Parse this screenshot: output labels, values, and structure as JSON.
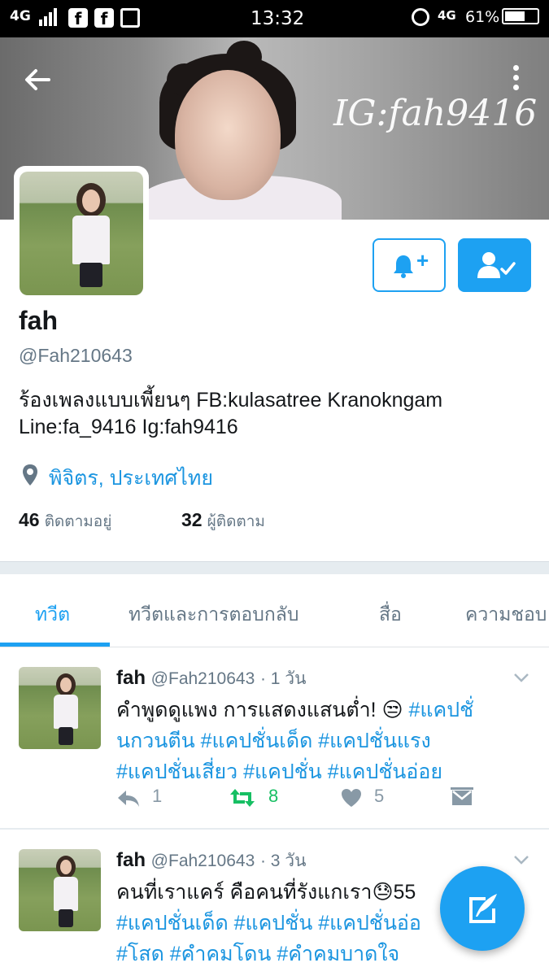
{
  "status_bar": {
    "network": "4G",
    "time": "13:32",
    "network2": "4G",
    "battery": "61%"
  },
  "banner": {
    "watermark": "IG:fah9416"
  },
  "profile": {
    "name": "fah",
    "handle": "@Fah210643",
    "bio": "ร้องเพลงแบบเพี้ยนๆ FB:kulasatree  Kranokngam Line:fa_9416 Ig:fah9416",
    "location": "พิจิตร, ประเทศไทย",
    "following_count": "46",
    "following_label": "ติดตามอยู่",
    "followers_count": "32",
    "followers_label": "ผู้ติดตาม"
  },
  "tabs": [
    {
      "label": "ทวีต",
      "active": true
    },
    {
      "label": "ทวีตและการตอบกลับ",
      "active": false
    },
    {
      "label": "สื่อ",
      "active": false
    },
    {
      "label": "ความชอบ",
      "active": false
    }
  ],
  "tweets": [
    {
      "name": "fah",
      "handle": "@Fah210643",
      "time": "· 1 วัน",
      "line1_text": "คำพูดดูแพง การแสดงแสนต่ำ! 😒 ",
      "line1_tag": "#แคปชั่",
      "line2": "นกวนตีน #แคปชั่นเด็ด #แคปชั่นแรง",
      "line3": "#แคปชั่นเสี่ยว #แคปชั่น #แคปชั่นอ่อย",
      "replies": "1",
      "retweets": "8",
      "likes": "5"
    },
    {
      "name": "fah",
      "handle": "@Fah210643",
      "time": "· 3 วัน",
      "line1_text": "คนที่เราแคร์ คือคนที่รังแกเรา😓55",
      "line2": "#แคปชั่นเด็ด #แคปชั่น #แคปชั่นอ่อ",
      "line3": "#โสด #คำคมโดน #คำคมบาดใจ"
    }
  ],
  "colors": {
    "accent": "#1da1f2",
    "retweet": "#17bf63",
    "muted": "#657786"
  }
}
